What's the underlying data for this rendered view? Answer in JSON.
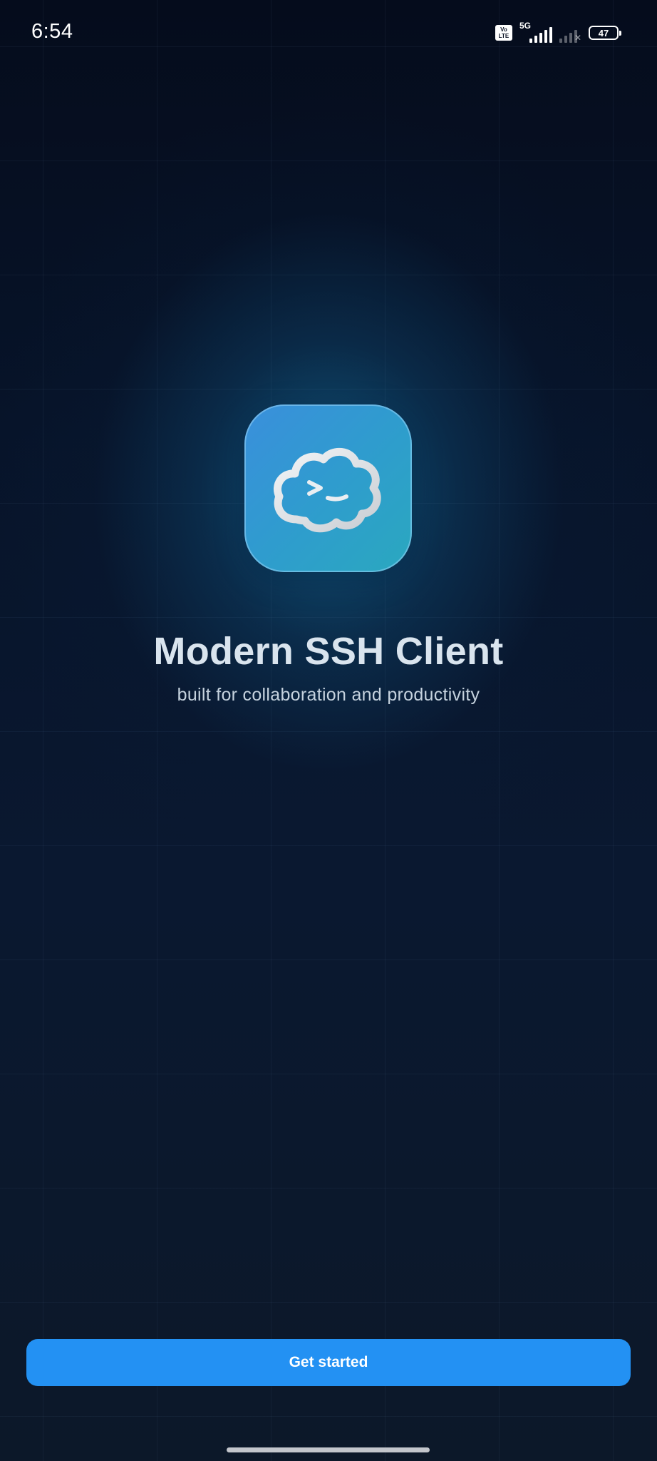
{
  "status_bar": {
    "time": "6:54",
    "volte_label": "Vo LTE",
    "network_label": "5G",
    "battery_level": "47"
  },
  "app_icon": {
    "name": "terminal-cloud-icon",
    "prompt_glyph": ">_"
  },
  "welcome": {
    "title": "Modern SSH Client",
    "subtitle": "built for collaboration and productivity"
  },
  "cta": {
    "label": "Get started"
  },
  "colors": {
    "accent": "#2391f3",
    "background": "#0b1325",
    "icon_gradient_start": "#3a8fdc",
    "icon_gradient_end": "#2aa8bf"
  }
}
